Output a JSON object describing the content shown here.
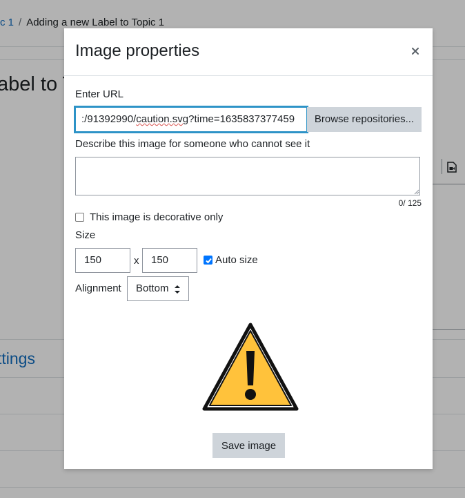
{
  "background": {
    "breadcrumb": {
      "link_fragment": "c 1",
      "separator": "/",
      "current": "Adding a new Label to Topic 1"
    },
    "heading_fragment": "abel to T",
    "settings_fragment": "ttings"
  },
  "modal": {
    "title": "Image properties",
    "close_icon": "close-icon",
    "url": {
      "label": "Enter URL",
      "value_prefix": ":/91392990/",
      "value_misspelled": "caution.svg",
      "value_suffix": "?time=1635837377459"
    },
    "browse_label": "Browse repositories...",
    "alt": {
      "label": "Describe this image for someone who cannot see it",
      "value": "",
      "char_count": "0/ 125"
    },
    "decorative_label": "This image is decorative only",
    "decorative_checked": false,
    "size": {
      "label": "Size",
      "width": "150",
      "height": "150",
      "separator": "x",
      "auto_label": "Auto size",
      "auto_checked": true
    },
    "alignment": {
      "label": "Alignment",
      "selected": "Bottom"
    },
    "preview_icon": "warning-triangle-icon",
    "save_label": "Save image"
  },
  "colors": {
    "focus_border": "#2d93c7",
    "button_bg": "#ced4da",
    "checkbox_checked": "#0075ff",
    "link": "#0f6cbf",
    "warning_fill": "#ffc23b"
  }
}
